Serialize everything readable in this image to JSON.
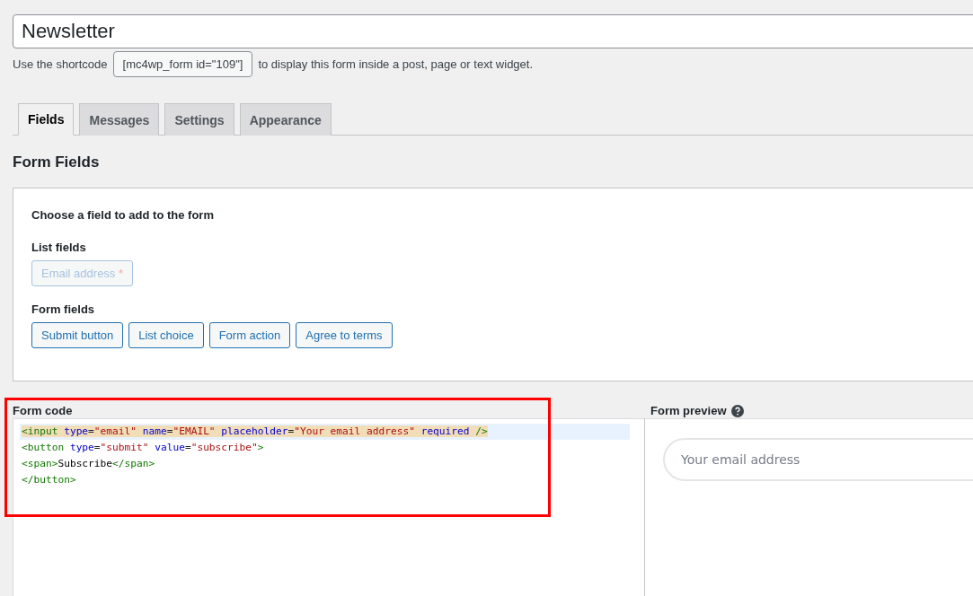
{
  "title_field": {
    "value": "Newsletter"
  },
  "shortcode": {
    "before": "Use the shortcode",
    "code": "[mc4wp_form id=\"109\"]",
    "after": "to display this form inside a post, page or text widget."
  },
  "tabs": [
    {
      "label": "Fields",
      "selected": true
    },
    {
      "label": "Messages",
      "selected": false
    },
    {
      "label": "Settings",
      "selected": false
    },
    {
      "label": "Appearance",
      "selected": false
    }
  ],
  "section_title": "Form Fields",
  "field_chooser": {
    "heading": "Choose a field to add to the form",
    "groups": [
      {
        "label": "List fields",
        "buttons": [
          {
            "label": "Email address",
            "required_mark": "*",
            "disabled": true
          }
        ]
      },
      {
        "label": "Form fields",
        "buttons": [
          {
            "label": "Submit button",
            "disabled": false
          },
          {
            "label": "List choice",
            "disabled": false
          },
          {
            "label": "Form action",
            "disabled": false
          },
          {
            "label": "Agree to terms",
            "disabled": false
          }
        ]
      }
    ]
  },
  "form_code": {
    "label": "Form code",
    "lines": [
      {
        "active": true,
        "tokens": [
          {
            "kind": "tag",
            "text": "<input"
          },
          {
            "kind": "attr",
            "text": " type"
          },
          {
            "kind": "punct",
            "text": "="
          },
          {
            "kind": "value",
            "text": "\"email\""
          },
          {
            "kind": "attr",
            "text": " name"
          },
          {
            "kind": "punct",
            "text": "="
          },
          {
            "kind": "value",
            "text": "\"EMAIL\""
          },
          {
            "kind": "attr",
            "text": " placeholder"
          },
          {
            "kind": "punct",
            "text": "="
          },
          {
            "kind": "value",
            "text": "\"Your email address\""
          },
          {
            "kind": "attr",
            "text": " required"
          },
          {
            "kind": "tag",
            "text": " />"
          }
        ]
      },
      {
        "active": false,
        "tokens": [
          {
            "kind": "tag",
            "text": "<button"
          },
          {
            "kind": "attr",
            "text": " type"
          },
          {
            "kind": "punct",
            "text": "="
          },
          {
            "kind": "value",
            "text": "\"submit\""
          },
          {
            "kind": "attr",
            "text": " value"
          },
          {
            "kind": "punct",
            "text": "="
          },
          {
            "kind": "value",
            "text": "\"subscribe\""
          },
          {
            "kind": "tag",
            "text": ">"
          }
        ]
      },
      {
        "active": false,
        "tokens": [
          {
            "kind": "tag",
            "text": "<span>"
          },
          {
            "kind": "text",
            "text": "Subscribe"
          },
          {
            "kind": "tag",
            "text": "</span>"
          }
        ]
      },
      {
        "active": false,
        "tokens": [
          {
            "kind": "tag",
            "text": "</button>"
          }
        ]
      }
    ]
  },
  "form_preview": {
    "label": "Form preview",
    "email_field": {
      "placeholder": "Your email address"
    }
  }
}
